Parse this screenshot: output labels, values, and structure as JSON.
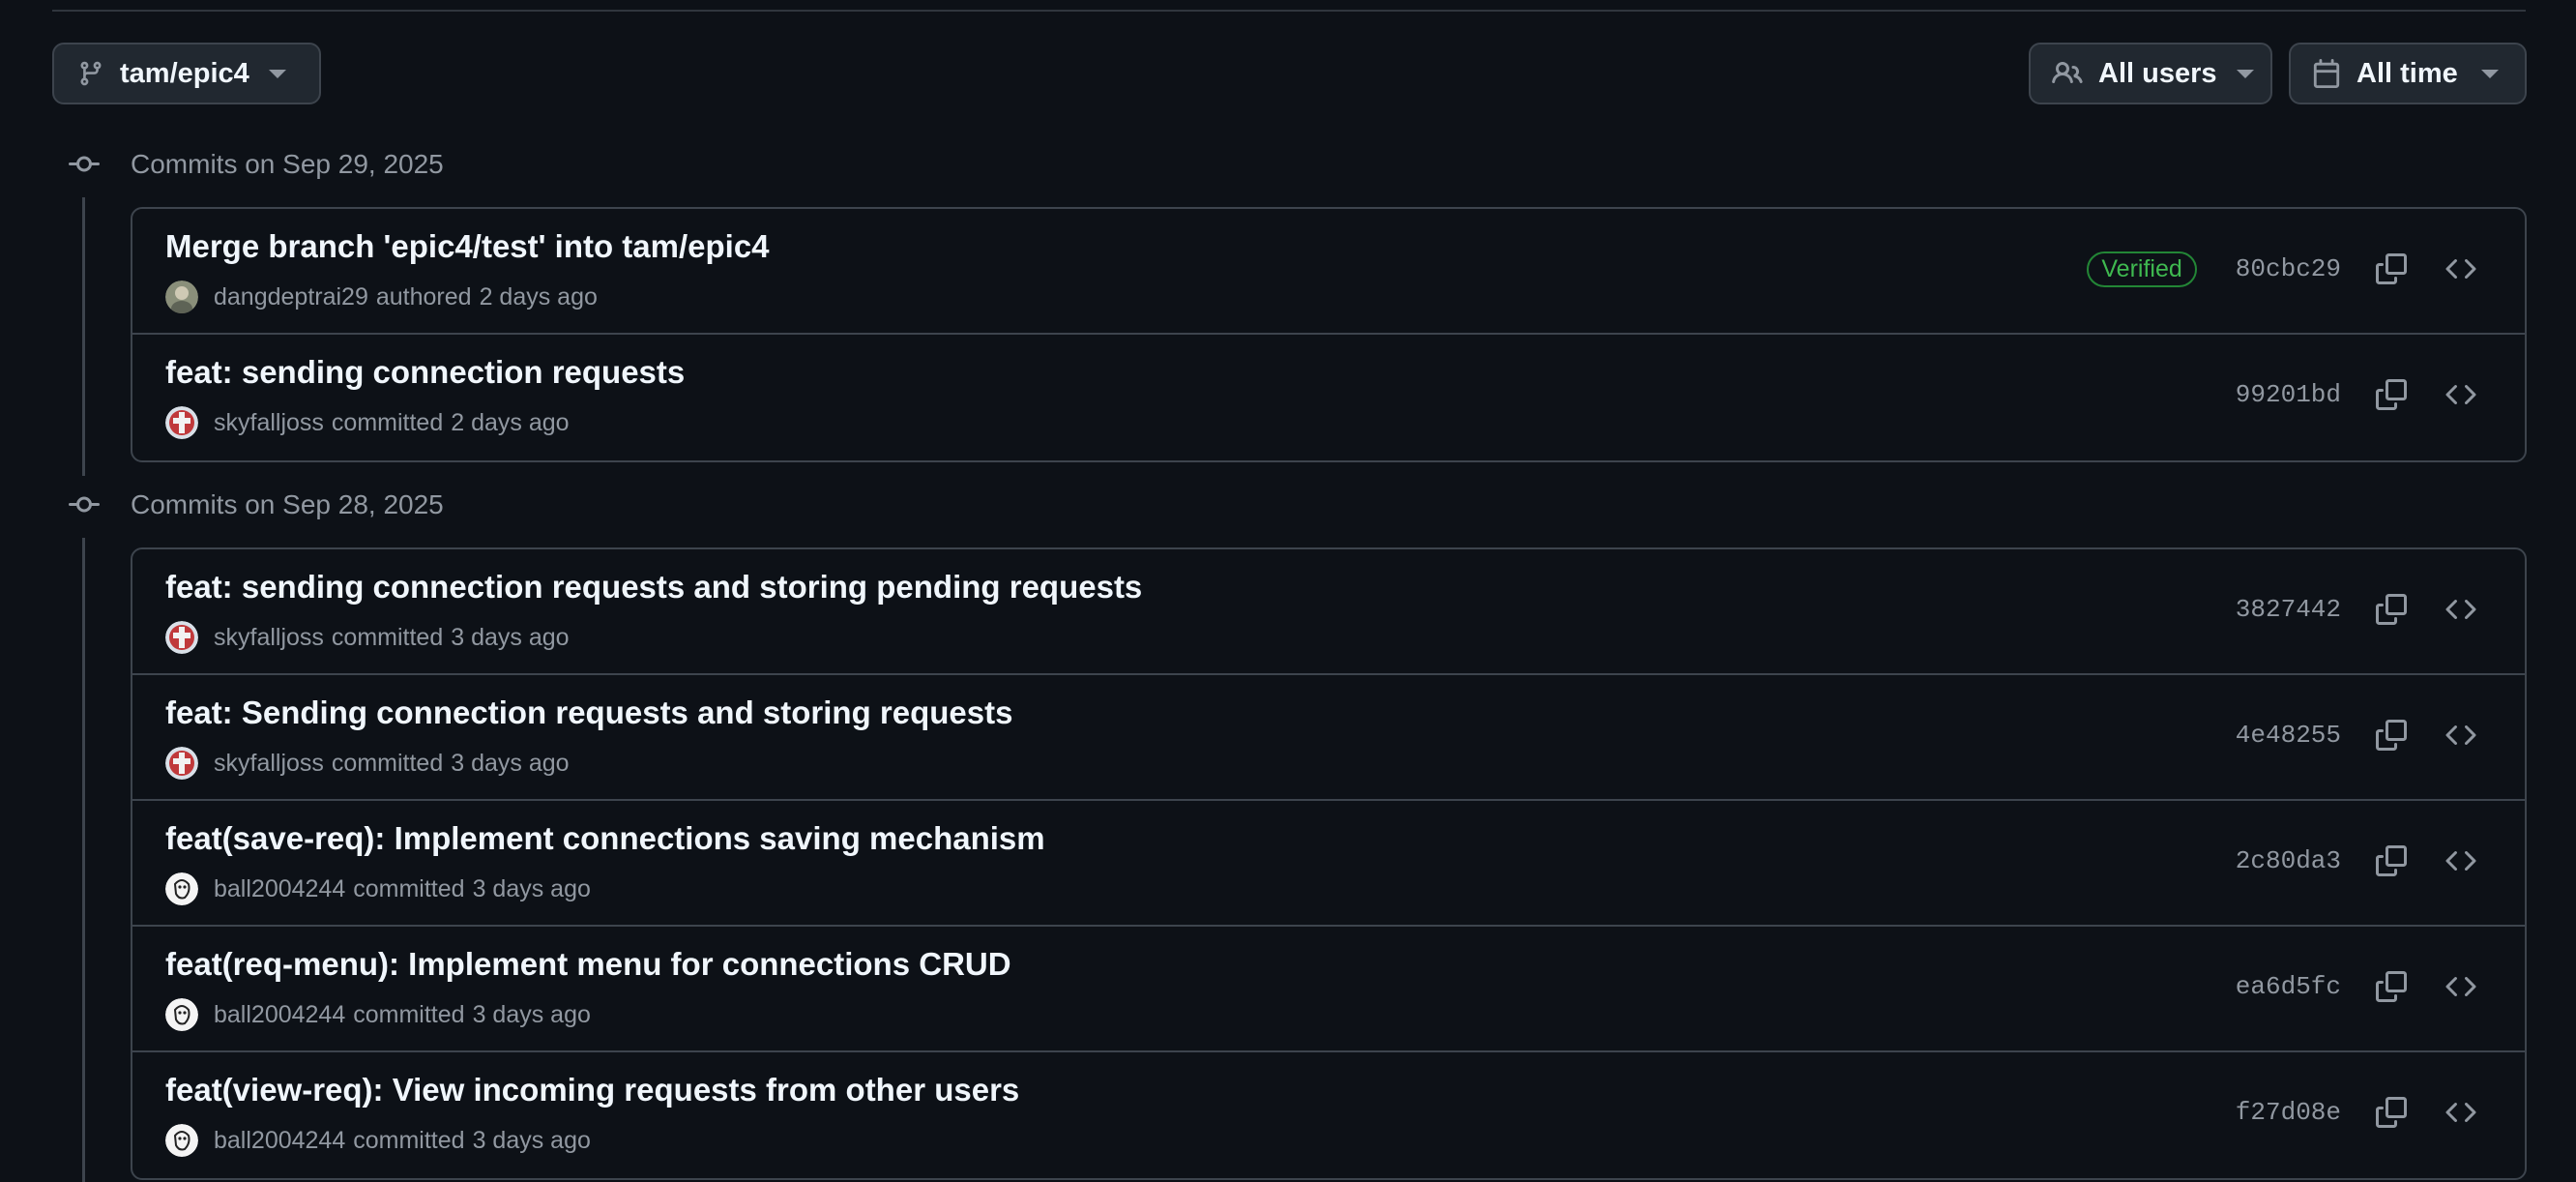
{
  "filters": {
    "branch_label": "tam/epic4",
    "users_label": "All users",
    "time_label": "All time"
  },
  "groups": [
    {
      "title": "Commits on Sep 29, 2025",
      "commits": [
        {
          "message": "Merge branch 'epic4/test' into tam/epic4",
          "author": "dangdeptrai29",
          "action": "authored",
          "time": "2 days ago",
          "badge": "Verified",
          "sha": "80cbc29",
          "avatar": "photo-avatar"
        },
        {
          "message": "feat: sending connection requests",
          "author": "skyfalljoss",
          "action": "committed",
          "time": "2 days ago",
          "badge": "",
          "sha": "99201bd",
          "avatar": "red-avatar"
        }
      ]
    },
    {
      "title": "Commits on Sep 28, 2025",
      "commits": [
        {
          "message": "feat: sending connection requests and storing pending requests",
          "author": "skyfalljoss",
          "action": "committed",
          "time": "3 days ago",
          "badge": "",
          "sha": "3827442",
          "avatar": "red-avatar"
        },
        {
          "message": "feat: Sending connection requests and storing requests",
          "author": "skyfalljoss",
          "action": "committed",
          "time": "3 days ago",
          "badge": "",
          "sha": "4e48255",
          "avatar": "red-avatar"
        },
        {
          "message": "feat(save-req): Implement connections saving mechanism",
          "author": "ball2004244",
          "action": "committed",
          "time": "3 days ago",
          "badge": "",
          "sha": "2c80da3",
          "avatar": "sketch-avatar"
        },
        {
          "message": "feat(req-menu): Implement menu for connections CRUD",
          "author": "ball2004244",
          "action": "committed",
          "time": "3 days ago",
          "badge": "",
          "sha": "ea6d5fc",
          "avatar": "sketch-avatar"
        },
        {
          "message": "feat(view-req): View incoming requests from other users",
          "author": "ball2004244",
          "action": "committed",
          "time": "3 days ago",
          "badge": "",
          "sha": "f27d08e",
          "avatar": "sketch-avatar"
        }
      ]
    }
  ],
  "icons": {
    "branch": "git-branch-icon",
    "users": "people-icon",
    "calendar": "calendar-icon",
    "commit_node": "git-commit-icon",
    "copy": "copy-icon",
    "browse": "code-icon"
  },
  "colors": {
    "background": "#0d1117",
    "border": "#3d444d",
    "verified": "#3fb950",
    "muted_text": "#9198a1"
  }
}
